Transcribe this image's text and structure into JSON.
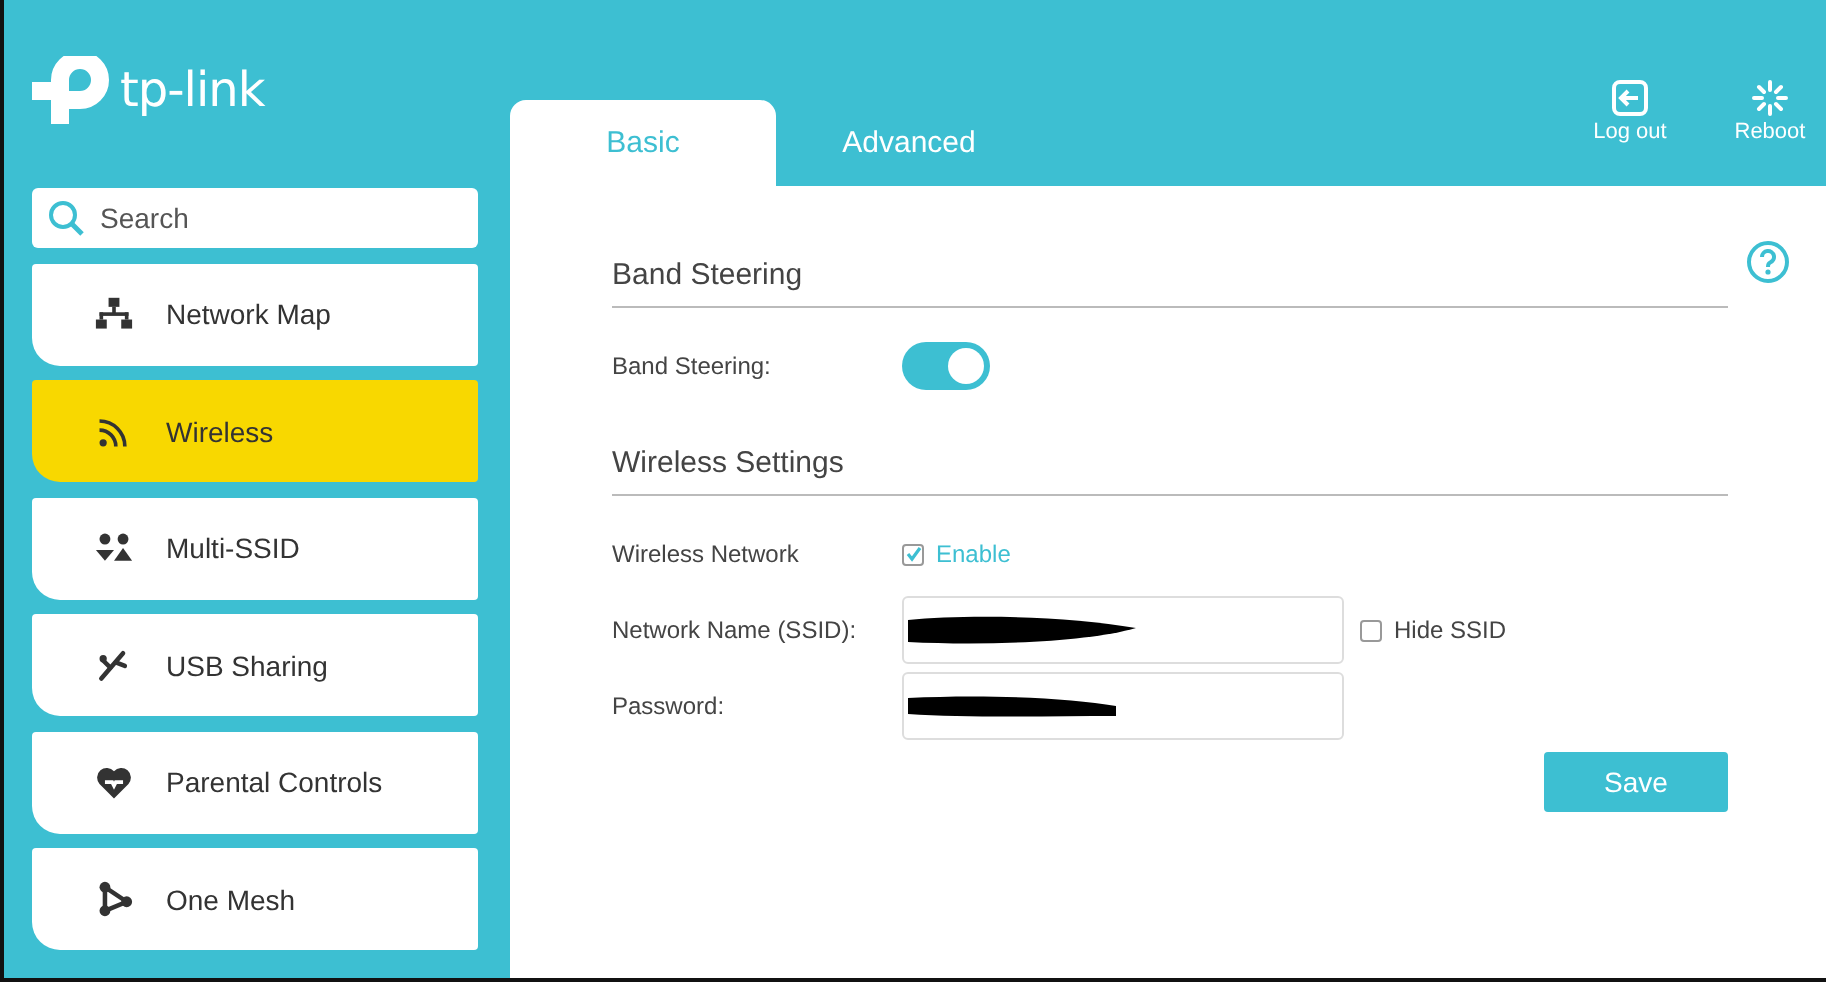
{
  "logo": {
    "text": "tp-link"
  },
  "tabs": [
    {
      "label": "Basic",
      "selected": true
    },
    {
      "label": "Advanced",
      "selected": false
    }
  ],
  "header_actions": [
    {
      "kind": "logout",
      "label": "Log out"
    },
    {
      "kind": "reboot",
      "label": "Reboot"
    }
  ],
  "sidebar": {
    "search": {
      "placeholder": "Search"
    },
    "items": [
      {
        "kind": "network-map",
        "label": "Network Map",
        "selected": false
      },
      {
        "kind": "wireless",
        "label": "Wireless",
        "selected": true
      },
      {
        "kind": "multi-ssid",
        "label": "Multi-SSID",
        "selected": false
      },
      {
        "kind": "usb",
        "label": "USB Sharing",
        "selected": false
      },
      {
        "kind": "parental",
        "label": "Parental Controls",
        "selected": false
      },
      {
        "kind": "mesh",
        "label": "One Mesh",
        "selected": false
      }
    ]
  },
  "sections": [
    {
      "title": "Band Steering",
      "rows": [
        {
          "kind": "toggle",
          "label": "Band Steering:",
          "on": true
        }
      ]
    },
    {
      "title": "Wireless Settings",
      "rows": [
        {
          "kind": "checkbox",
          "label": "Wireless Network",
          "option": "Enable",
          "checked": true
        },
        {
          "kind": "text",
          "label": "Network Name (SSID):",
          "redacted": true,
          "extra": {
            "label": "Hide SSID",
            "checked": false
          }
        },
        {
          "kind": "text",
          "label": "Password:",
          "redacted": true
        }
      ]
    }
  ],
  "save_button": {
    "label": "Save"
  }
}
